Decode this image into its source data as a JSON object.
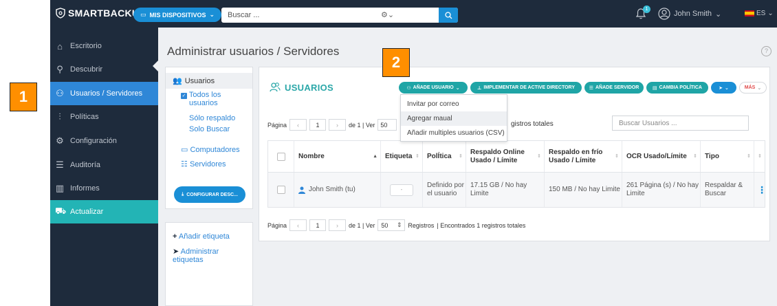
{
  "topbar": {
    "brand": "SMARTBACKUP",
    "devices_button": "MIS DISPOSITIVOS",
    "search_placeholder": "Buscar ...",
    "notification_count": "1",
    "user_name": "John Smith",
    "language": "ES"
  },
  "sidebar": {
    "items": [
      {
        "label": "Escritorio",
        "icon": "home-icon"
      },
      {
        "label": "Descubrir",
        "icon": "search-icon"
      },
      {
        "label": "Usuarios / Servidores",
        "icon": "users-icon",
        "active": true
      },
      {
        "label": "Políticas",
        "icon": "sliders-icon"
      },
      {
        "label": "Configuración",
        "icon": "gear-icon"
      },
      {
        "label": "Auditoría",
        "icon": "list-icon"
      },
      {
        "label": "Informes",
        "icon": "bar-chart-icon"
      },
      {
        "label": "Actualizar",
        "icon": "cart-icon",
        "highlight": true
      }
    ]
  },
  "page": {
    "title": "Administrar usuarios / Servidores",
    "help": "?"
  },
  "left_panel": {
    "heading": "Usuarios",
    "todos": "Todos los usuarios",
    "todos_line1": "Todos los",
    "todos_line2": "usuarios",
    "solo_respaldo": "Sólo respaldo",
    "solo_buscar": "Solo Buscar",
    "computadores": "Computadores",
    "servidores": "Servidores",
    "configurar": "CONFIGURAR DESC..."
  },
  "tag_panel": {
    "add_tag": "Añadir etiqueta",
    "manage_tags_line1": "Administrar",
    "manage_tags_line2": "etiquetas"
  },
  "main": {
    "section_title": "USUARIOS",
    "buttons": {
      "add_user": "AÑADE USUARIO",
      "active_directory": "IMPLEMENTAR DE ACTIVE DIRECTORY",
      "add_server": "AÑADE SERVIDOR",
      "change_policy": "CAMBIA POLÍTICA",
      "more": "MÁS"
    },
    "dropdown": [
      "Invitar por correo",
      "Agregar maual",
      "Añadir multiples usuarios (CSV)"
    ],
    "pagination_top": {
      "label": "Página",
      "page": "1",
      "of_text": "de 1 | Ver",
      "per_page": "50",
      "total_visible": "gistros totales"
    },
    "pagination_bottom": {
      "label": "Página",
      "page": "1",
      "of_text": "de 1 | Ver",
      "per_page": "50",
      "registros": "Registros",
      "found": "| Encontrados 1 registros totales"
    },
    "user_search_placeholder": "Buscar Usuarios ...",
    "table": {
      "headers": [
        "Nombre",
        "Etiqueta",
        "PolÍtica",
        "Respaldo Online Usado / Límite",
        "Respaldo en frío Usado / Límite",
        "OCR Usado/Límite",
        "Tipo"
      ],
      "rows": [
        {
          "name": "John Smith (tu)",
          "tag": "-",
          "policy": "Definido por el usuario",
          "online": "17.15 GB / No hay Limite",
          "cold": "150 MB / No hay Limite",
          "ocr": "261 Página (s) / No hay Limite",
          "type": "Respaldar & Buscar"
        }
      ]
    }
  },
  "callouts": [
    "1",
    "2"
  ]
}
